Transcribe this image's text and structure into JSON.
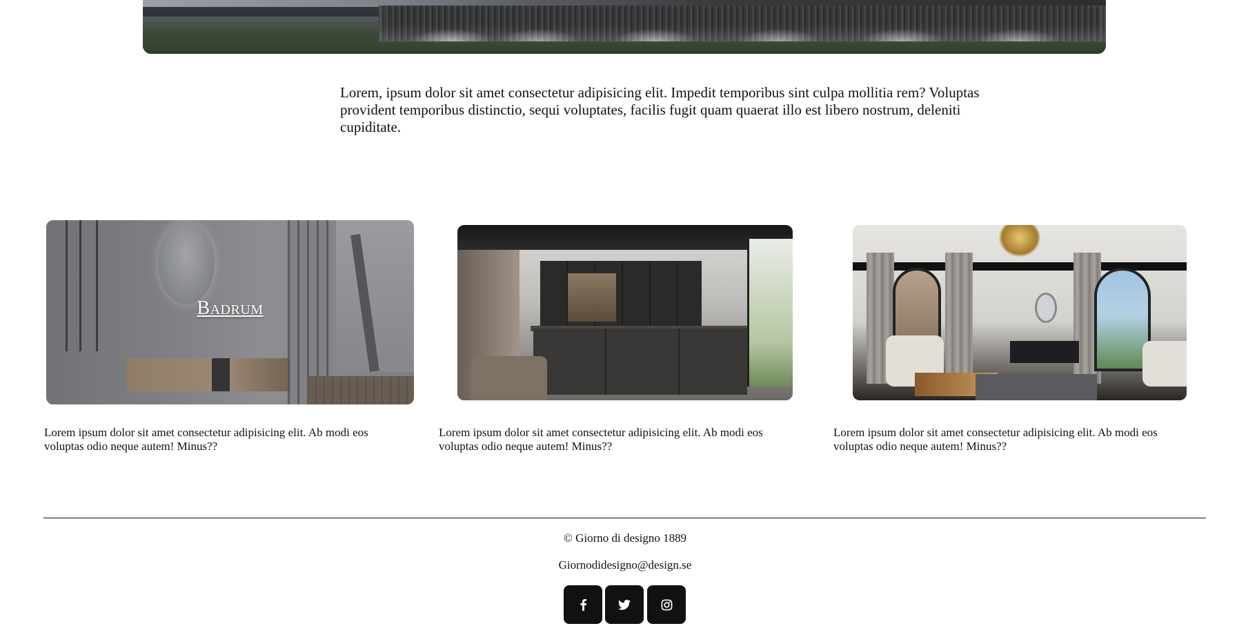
{
  "intro": {
    "text": "Lorem, ipsum dolor sit amet consectetur adipisicing elit. Impedit temporibus sint culpa mollitia rem? Voluptas provident temporibus distinctio, sequi voluptates, facilis fugit quam quaerat illo est libero nostrum, deleniti cupiditate."
  },
  "cards": [
    {
      "overlay_label": "Badrum",
      "caption": "Lorem ipsum dolor sit amet consectetur adipisicing elit. Ab modi eos voluptas odio neque autem! Minus??"
    },
    {
      "caption": "Lorem ipsum dolor sit amet consectetur adipisicing elit. Ab modi eos voluptas odio neque autem! Minus??"
    },
    {
      "caption": "Lorem ipsum dolor sit amet consectetur adipisicing elit. Ab modi eos voluptas odio neque autem! Minus??"
    }
  ],
  "footer": {
    "copyright": "© Giorno di designo 1889",
    "email": "Giornodidesigno@design.se",
    "social": [
      {
        "icon": "facebook-icon"
      },
      {
        "icon": "twitter-icon"
      },
      {
        "icon": "instagram-icon"
      }
    ]
  },
  "colors": {
    "text": "#111111",
    "social_bg": "#111111",
    "social_icon": "#ffffff",
    "background": "#ffffff"
  }
}
